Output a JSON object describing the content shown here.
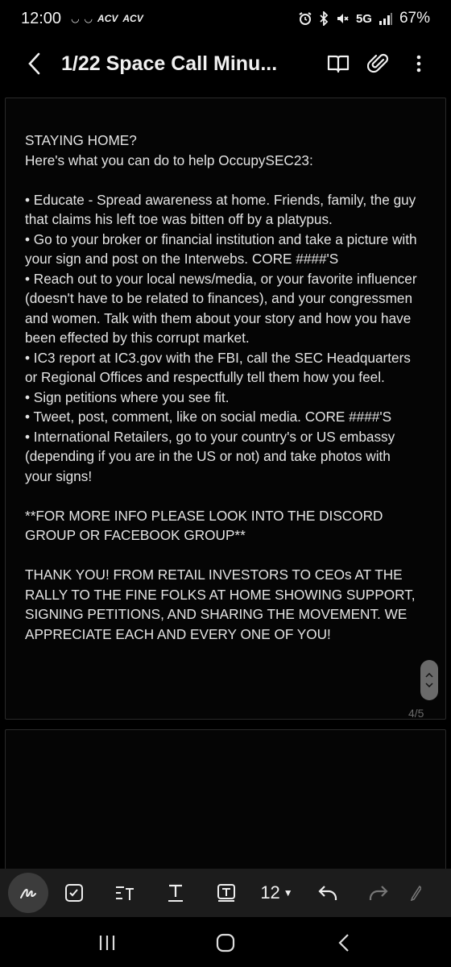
{
  "status_bar": {
    "time": "12:00",
    "notif_icons": [
      "◡",
      "◡",
      "ACV",
      "ACV"
    ],
    "network": "5G",
    "battery": "67%"
  },
  "app_bar": {
    "title": "1/22 Space Call Minu..."
  },
  "note": {
    "body": "STAYING HOME?\nHere's what you can do to help OccupySEC23:\n\n• Educate - Spread awareness at home. Friends, family, the guy that claims his left toe was bitten off by a platypus.\n• Go to your broker or financial institution and take a picture with your sign and post on the Interwebs. CORE ####'S\n• Reach out to your local news/media, or your favorite influencer (doesn't have to be related to finances), and your congressmen and women. Talk with them about your story and how you have been effected by this corrupt market.\n• IC3 report at IC3.gov with the FBI, call the SEC Headquarters or Regional Offices and respectfully tell them how you feel.\n• Sign petitions where you see fit.\n• Tweet, post, comment, like on social media. CORE ####'S\n• International Retailers, go to your country's or US embassy (depending if you are in the US or not) and take photos with your signs!\n\n**FOR MORE INFO PLEASE LOOK INTO THE DISCORD GROUP OR FACEBOOK GROUP**\n\nTHANK YOU! FROM RETAIL INVESTORS TO CEOs AT THE RALLY TO THE FINE FOLKS AT HOME SHOWING SUPPORT, SIGNING PETITIONS, AND SHARING THE MOVEMENT. WE APPRECIATE EACH AND EVERY ONE OF YOU!",
    "page_indicator": "4/5"
  },
  "pen_toolbar": {
    "font_size": "12"
  },
  "colors": {
    "background": "#000000",
    "toolbar": "#1c1c1c",
    "text": "#e4e4e4"
  }
}
